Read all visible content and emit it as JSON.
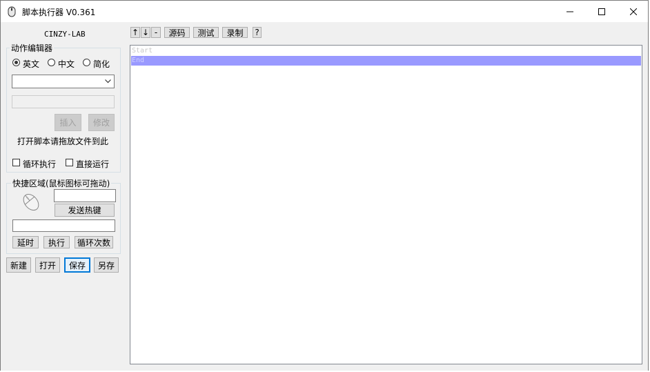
{
  "window": {
    "title": "脚本执行器 V0.361"
  },
  "brand": {
    "text": "CINZY-LAB"
  },
  "toolbar": {
    "up_label": "↑",
    "down_label": "↓",
    "delete_label": "-",
    "source_label": "源码",
    "test_label": "测试",
    "record_label": "录制",
    "help_label": "?"
  },
  "action_editor": {
    "title": "动作编辑器",
    "radios": [
      {
        "label": "英文",
        "checked": true
      },
      {
        "label": "中文",
        "checked": false
      },
      {
        "label": "简化",
        "checked": false
      }
    ],
    "combo_value": "",
    "param_value": "",
    "insert_label": "插入",
    "modify_label": "修改",
    "hint": "打开脚本请拖放文件到此",
    "loop_label": "循环执行",
    "direct_label": "直接运行"
  },
  "quick_area": {
    "title": "快捷区域(鼠标图标可拖动)",
    "hotkey_value": "",
    "send_hotkey_label": "发送热键",
    "text_value": "",
    "delay_label": "延时",
    "exec_label": "执行",
    "loop_count_label": "循环次数"
  },
  "file_buttons": {
    "new_label": "新建",
    "open_label": "打开",
    "save_label": "保存",
    "save_as_label": "另存"
  },
  "script_list": {
    "rows": [
      "Start",
      "End"
    ],
    "selected_index": 1
  }
}
